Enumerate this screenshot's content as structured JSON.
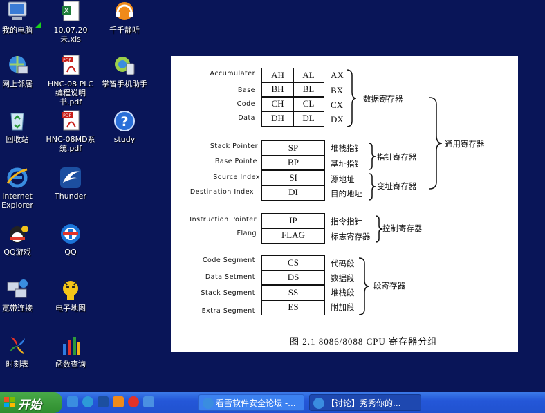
{
  "desktop": {
    "icons": [
      {
        "label": "我的电脑",
        "icon": "my-computer-icon"
      },
      {
        "label": "10.07.20未.xls",
        "icon": "excel-file-icon"
      },
      {
        "label": "千千静听",
        "icon": "ttplayer-icon"
      },
      {
        "label": "网上邻居",
        "icon": "network-places-icon"
      },
      {
        "label": "HNC-08 PLC编程说明书.pdf",
        "icon": "pdf-file-icon"
      },
      {
        "label": "掌智手机助手",
        "icon": "phone-assistant-icon"
      },
      {
        "label": "回收站",
        "icon": "recycle-bin-icon"
      },
      {
        "label": "HNC-08MD系统.pdf",
        "icon": "pdf-file-icon"
      },
      {
        "label": "study",
        "icon": "help-icon"
      },
      {
        "label": "Internet Explorer",
        "icon": "ie-icon"
      },
      {
        "label": "Thunder",
        "icon": "thunder-icon"
      },
      {
        "label": "QQ游戏",
        "icon": "qq-game-icon"
      },
      {
        "label": "QQ",
        "icon": "qq-icon"
      },
      {
        "label": "宽带连接",
        "icon": "broadband-icon"
      },
      {
        "label": "电子地图",
        "icon": "map-icon"
      },
      {
        "label": "时刻表",
        "icon": "timetable-icon"
      },
      {
        "label": "函数查询",
        "icon": "function-query-icon"
      }
    ]
  },
  "figure": {
    "caption": "图 2.1   8086/8088 CPU 寄存器分组",
    "data_regs": [
      {
        "label": "Accumulater",
        "hi": "AH",
        "lo": "AL",
        "x": "AX"
      },
      {
        "label": "Base",
        "hi": "BH",
        "lo": "BL",
        "x": "BX"
      },
      {
        "label": "Code",
        "hi": "CH",
        "lo": "CL",
        "x": "CX"
      },
      {
        "label": "Data",
        "hi": "DH",
        "lo": "DL",
        "x": "DX"
      }
    ],
    "data_group": "数据寄存器",
    "general_group": "通用寄存器",
    "pointer_regs": [
      {
        "label": "Stack Pointer",
        "name": "SP",
        "desc": "堆栈指针"
      },
      {
        "label": "Base Pointe",
        "name": "BP",
        "desc": "基址指针"
      }
    ],
    "pointer_group": "指针寄存器",
    "index_regs": [
      {
        "label": "Source Index",
        "name": "SI",
        "desc": "源地址"
      },
      {
        "label": "Destination Index",
        "name": "DI",
        "desc": "目的地址"
      }
    ],
    "index_group": "变址寄存器",
    "control_regs": [
      {
        "label": "Instruction Pointer",
        "name": "IP",
        "desc": "指令指针"
      },
      {
        "label": "Flang",
        "name": "FLAG",
        "desc": "标志寄存器"
      }
    ],
    "control_group": "控制寄存器",
    "segment_regs": [
      {
        "label": "Code Segment",
        "name": "CS",
        "desc": "代码段"
      },
      {
        "label": "Data Setment",
        "name": "DS",
        "desc": "数据段"
      },
      {
        "label": "Stack Segment",
        "name": "SS",
        "desc": "堆栈段"
      },
      {
        "label": "Extra Segment",
        "name": "ES",
        "desc": "附加段"
      }
    ],
    "segment_group": "段寄存器"
  },
  "taskbar": {
    "start_label": "开始",
    "tasks": [
      {
        "label": "看雪软件安全论坛 -..."
      },
      {
        "label": "【讨论】秀秀你的..."
      }
    ]
  },
  "colors": {
    "desktop": "#091558",
    "taskbar": "#2457d8",
    "start": "#3a9a3a"
  }
}
